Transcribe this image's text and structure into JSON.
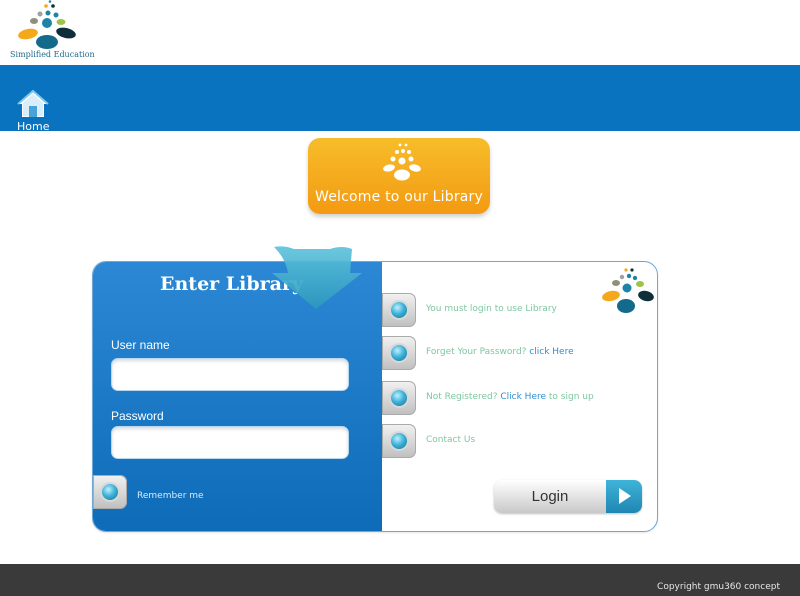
{
  "brand": {
    "name": "Simplified Education"
  },
  "nav": {
    "home_label": "Home"
  },
  "welcome": {
    "text": "Welcome to our Library"
  },
  "login_panel": {
    "title": "Enter Library",
    "username_label": "User name",
    "username_value": "",
    "password_label": "Password",
    "password_value": "",
    "remember_label": "Remember me"
  },
  "info_items": [
    {
      "text": "You must login to use Library",
      "link": ""
    },
    {
      "text": "Forget Your Password? ",
      "link": "click Here",
      "suffix": ""
    },
    {
      "text": "Not Registered? ",
      "link": "Click Here",
      "suffix": " to sign up"
    },
    {
      "text": "Contact Us",
      "link": ""
    }
  ],
  "login_button": {
    "label": "Login"
  },
  "footer": {
    "copyright": "Copyright gmu360 concept"
  },
  "colors": {
    "nav_blue": "#0a73bf",
    "panel_blue": "#1a7bc8",
    "bubble_orange": "#f5a91d",
    "teal": "#2aa3c9",
    "footer_dark": "#3a3a3a",
    "item_text_green": "#7fc7a0"
  }
}
